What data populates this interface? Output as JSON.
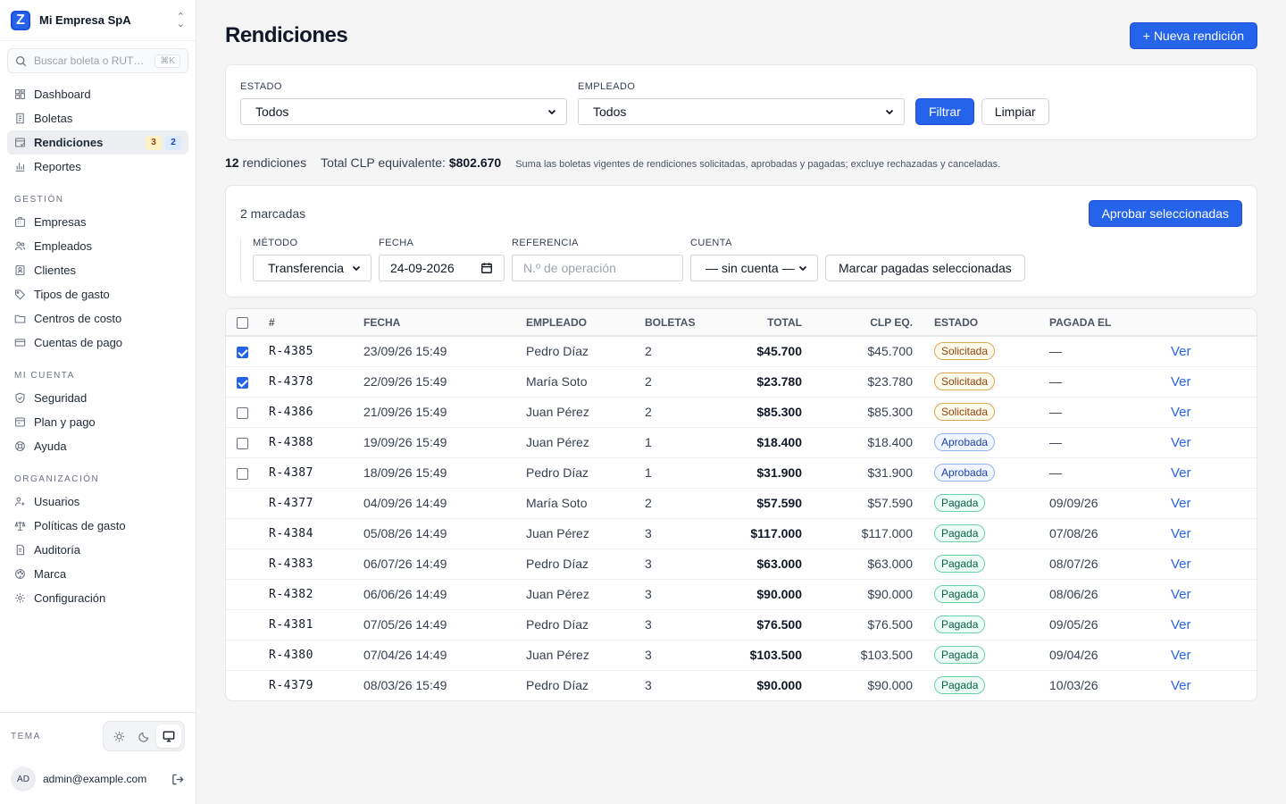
{
  "brand": {
    "name": "Mi Empresa SpA"
  },
  "search": {
    "placeholder": "Buscar boleta o RUT…",
    "shortcut": "⌘K"
  },
  "nav_main": [
    {
      "label": "Dashboard",
      "icon": "dashboard-icon"
    },
    {
      "label": "Boletas",
      "icon": "receipt-icon"
    },
    {
      "label": "Rendiciones",
      "icon": "rendiciones-icon",
      "active": true,
      "badge_pending": "3",
      "badge_approved": "2"
    },
    {
      "label": "Reportes",
      "icon": "chart-icon"
    }
  ],
  "sections": {
    "gestion": {
      "title": "GESTIÓN",
      "items": [
        "Empresas",
        "Empleados",
        "Clientes",
        "Tipos de gasto",
        "Centros de costo",
        "Cuentas de pago"
      ]
    },
    "mi_cuenta": {
      "title": "MI CUENTA",
      "items": [
        "Seguridad",
        "Plan y pago",
        "Ayuda"
      ]
    },
    "organizacion": {
      "title": "ORGANIZACIÓN",
      "items": [
        "Usuarios",
        "Políticas de gasto",
        "Auditoría",
        "Marca",
        "Configuración"
      ]
    }
  },
  "footer": {
    "theme_label": "TEMA",
    "avatar": "AD",
    "email": "admin@example.com"
  },
  "page": {
    "title": "Rendiciones",
    "new_button": "+ Nueva rendición"
  },
  "filters": {
    "estado_label": "ESTADO",
    "estado_value": "Todos",
    "empleado_label": "EMPLEADO",
    "empleado_value": "Todos",
    "filter_button": "Filtrar",
    "clear_button": "Limpiar"
  },
  "summary": {
    "count": "12",
    "count_suffix": "rendiciones",
    "total_label": "Total CLP equivalente:",
    "total_value": "$802.670",
    "note": "Suma las boletas vigentes de rendiciones solicitadas, aprobadas y pagadas; excluye rechazadas y canceladas."
  },
  "bulk": {
    "marked": "2 marcadas",
    "approve_button": "Aprobar seleccionadas",
    "metodo_label": "MÉTODO",
    "metodo_value": "Transferencia",
    "fecha_label": "FECHA",
    "fecha_value": "24-09-2026",
    "referencia_label": "REFERENCIA",
    "referencia_placeholder": "N.º de operación",
    "cuenta_label": "CUENTA",
    "cuenta_value": "— sin cuenta —",
    "mark_paid_button": "Marcar pagadas seleccionadas"
  },
  "table": {
    "headers": {
      "id": "#",
      "fecha": "FECHA",
      "empleado": "EMPLEADO",
      "boletas": "BOLETAS",
      "total": "TOTAL",
      "clp": "CLP EQ.",
      "estado": "ESTADO",
      "pagada": "PAGADA EL"
    },
    "view_label": "Ver",
    "rows": [
      {
        "id": "R-4385",
        "fecha": "23/09/26 15:49",
        "empleado": "Pedro Díaz",
        "boletas": "2",
        "total": "$45.700",
        "clp": "$45.700",
        "estado": "Solicitada",
        "pagada": "—",
        "checkbox": true,
        "checked": true
      },
      {
        "id": "R-4378",
        "fecha": "22/09/26 15:49",
        "empleado": "María Soto",
        "boletas": "2",
        "total": "$23.780",
        "clp": "$23.780",
        "estado": "Solicitada",
        "pagada": "—",
        "checkbox": true,
        "checked": true
      },
      {
        "id": "R-4386",
        "fecha": "21/09/26 15:49",
        "empleado": "Juan Pérez",
        "boletas": "2",
        "total": "$85.300",
        "clp": "$85.300",
        "estado": "Solicitada",
        "pagada": "—",
        "checkbox": true,
        "checked": false
      },
      {
        "id": "R-4388",
        "fecha": "19/09/26 15:49",
        "empleado": "Juan Pérez",
        "boletas": "1",
        "total": "$18.400",
        "clp": "$18.400",
        "estado": "Aprobada",
        "pagada": "—",
        "checkbox": true,
        "checked": false
      },
      {
        "id": "R-4387",
        "fecha": "18/09/26 15:49",
        "empleado": "Pedro Díaz",
        "boletas": "1",
        "total": "$31.900",
        "clp": "$31.900",
        "estado": "Aprobada",
        "pagada": "—",
        "checkbox": true,
        "checked": false
      },
      {
        "id": "R-4377",
        "fecha": "04/09/26 14:49",
        "empleado": "María Soto",
        "boletas": "2",
        "total": "$57.590",
        "clp": "$57.590",
        "estado": "Pagada",
        "pagada": "09/09/26",
        "checkbox": false,
        "checked": false
      },
      {
        "id": "R-4384",
        "fecha": "05/08/26 14:49",
        "empleado": "Juan Pérez",
        "boletas": "3",
        "total": "$117.000",
        "clp": "$117.000",
        "estado": "Pagada",
        "pagada": "07/08/26",
        "checkbox": false,
        "checked": false
      },
      {
        "id": "R-4383",
        "fecha": "06/07/26 14:49",
        "empleado": "Pedro Díaz",
        "boletas": "3",
        "total": "$63.000",
        "clp": "$63.000",
        "estado": "Pagada",
        "pagada": "08/07/26",
        "checkbox": false,
        "checked": false
      },
      {
        "id": "R-4382",
        "fecha": "06/06/26 14:49",
        "empleado": "Juan Pérez",
        "boletas": "3",
        "total": "$90.000",
        "clp": "$90.000",
        "estado": "Pagada",
        "pagada": "08/06/26",
        "checkbox": false,
        "checked": false
      },
      {
        "id": "R-4381",
        "fecha": "07/05/26 14:49",
        "empleado": "Pedro Díaz",
        "boletas": "3",
        "total": "$76.500",
        "clp": "$76.500",
        "estado": "Pagada",
        "pagada": "09/05/26",
        "checkbox": false,
        "checked": false
      },
      {
        "id": "R-4380",
        "fecha": "07/04/26 14:49",
        "empleado": "Juan Pérez",
        "boletas": "3",
        "total": "$103.500",
        "clp": "$103.500",
        "estado": "Pagada",
        "pagada": "09/04/26",
        "checkbox": false,
        "checked": false
      },
      {
        "id": "R-4379",
        "fecha": "08/03/26 15:49",
        "empleado": "Pedro Díaz",
        "boletas": "3",
        "total": "$90.000",
        "clp": "$90.000",
        "estado": "Pagada",
        "pagada": "10/03/26",
        "checkbox": false,
        "checked": false
      }
    ]
  },
  "colors": {
    "accent": "#2563eb",
    "solicitada": "#92400e",
    "aprobada": "#1e40af",
    "pagada": "#065f46"
  }
}
